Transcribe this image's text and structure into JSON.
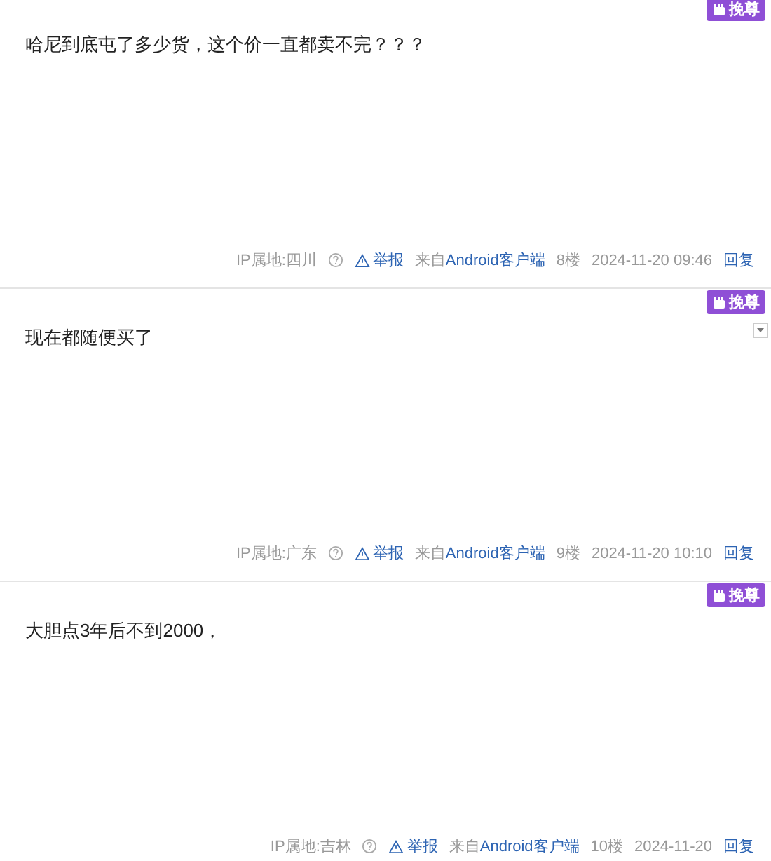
{
  "posts": [
    {
      "badge": "挽尊",
      "has_menu": false,
      "content": "哈尼到底屯了多少货，这个价一直都卖不完？？？",
      "ip": "IP属地:四川",
      "report": "举报",
      "source_prefix": "来自",
      "source": "Android客户端",
      "floor": "8楼",
      "time": "2024-11-20 09:46",
      "reply": "回复"
    },
    {
      "badge": "挽尊",
      "has_menu": true,
      "content": "现在都随便买了",
      "ip": "IP属地:广东",
      "report": "举报",
      "source_prefix": "来自",
      "source": "Android客户端",
      "floor": "9楼",
      "time": "2024-11-20 10:10",
      "reply": "回复"
    },
    {
      "badge": "挽尊",
      "has_menu": false,
      "content": "大胆点3年后不到2000，",
      "ip": "IP属地:吉林",
      "report": "举报",
      "source_prefix": "来自",
      "source": "Android客户端",
      "floor": "10楼",
      "time": "2024-11-20",
      "reply": "回复"
    }
  ]
}
